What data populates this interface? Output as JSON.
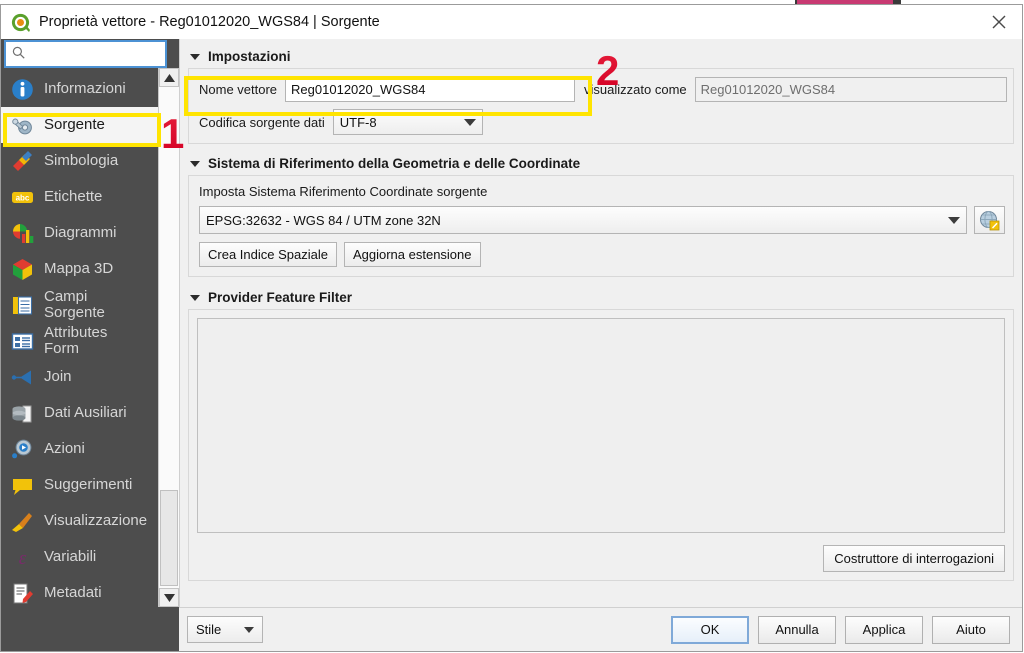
{
  "window": {
    "title": "Proprietà vettore - Reg01012020_WGS84 | Sorgente",
    "logo_icon": "qgis-logo-icon",
    "close_icon": "close-icon"
  },
  "search": {
    "value": "",
    "placeholder": "",
    "icon": "search-icon"
  },
  "sidebar": {
    "items": [
      {
        "label": "Informazioni",
        "icon": "info-icon",
        "selected": false
      },
      {
        "label": "Sorgente",
        "icon": "wrench-gear-icon",
        "selected": true
      },
      {
        "label": "Simbologia",
        "icon": "paintbrush-icon",
        "selected": false
      },
      {
        "label": "Etichette",
        "icon": "abc-label-icon",
        "selected": false
      },
      {
        "label": "Diagrammi",
        "icon": "bar-chart-icon",
        "selected": false
      },
      {
        "label": "Mappa 3D",
        "icon": "cube-3d-icon",
        "selected": false
      },
      {
        "label": "Campi\nSorgente",
        "icon": "fields-table-icon",
        "selected": false
      },
      {
        "label": "Attributes\nForm",
        "icon": "form-layout-icon",
        "selected": false
      },
      {
        "label": "Join",
        "icon": "join-arrow-icon",
        "selected": false
      },
      {
        "label": "Dati Ausiliari",
        "icon": "database-copy-icon",
        "selected": false
      },
      {
        "label": "Azioni",
        "icon": "gear-play-icon",
        "selected": false
      },
      {
        "label": "Suggerimenti",
        "icon": "speech-bubble-icon",
        "selected": false
      },
      {
        "label": "Visualizzazione",
        "icon": "broom-icon",
        "selected": false
      },
      {
        "label": "Variabili",
        "icon": "epsilon-icon",
        "selected": false
      },
      {
        "label": "Metadati",
        "icon": "document-edit-icon",
        "selected": false
      }
    ],
    "scroll_up_icon": "scroll-up-arrow-icon",
    "scroll_down_icon": "scroll-down-arrow-icon"
  },
  "settings_group": {
    "title": "Impostazioni",
    "layer_name_label": "Nome vettore",
    "layer_name_value": "Reg01012020_WGS84",
    "displayed_as_label": "visualizzato come",
    "displayed_as_value": "Reg01012020_WGS84",
    "encoding_label": "Codifica sorgente dati",
    "encoding_value": "UTF-8"
  },
  "crs_group": {
    "title": "Sistema di Riferimento della Geometria e delle Coordinate",
    "set_crs_label": "Imposta Sistema Riferimento Coordinate sorgente",
    "crs_value": "EPSG:32632 - WGS 84 / UTM zone 32N",
    "globe_button_icon": "crs-globe-icon",
    "create_index_button": "Crea Indice Spaziale",
    "update_extent_button": "Aggiorna estensione"
  },
  "filter_group": {
    "title": "Provider Feature Filter",
    "filter_value": "",
    "query_builder_button": "Costruttore di interrogazioni"
  },
  "footer": {
    "style_button": "Stile",
    "ok_button": "OK",
    "cancel_button": "Annulla",
    "apply_button": "Applica",
    "help_button": "Aiuto"
  },
  "annotations": {
    "marker_1": "1",
    "marker_2": "2",
    "highlight_color": "#ffe400",
    "marker_color": "#e8102a"
  }
}
